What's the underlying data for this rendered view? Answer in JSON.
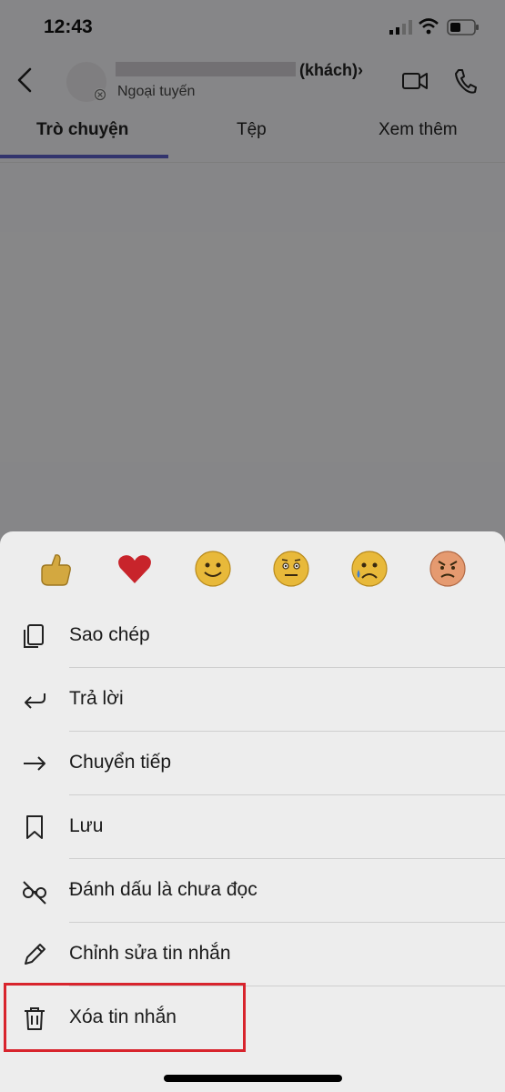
{
  "status_bar": {
    "time": "12:43"
  },
  "header": {
    "name_suffix": "(khách)›",
    "presence_text": "Ngoại tuyến"
  },
  "tabs": [
    {
      "label": "Trò chuyện"
    },
    {
      "label": "Tệp"
    },
    {
      "label": "Xem thêm"
    }
  ],
  "reactions": [
    {
      "icon": "like-emoji-icon"
    },
    {
      "icon": "heart-emoji-icon"
    },
    {
      "icon": "smile-emoji-icon"
    },
    {
      "icon": "surprised-emoji-icon"
    },
    {
      "icon": "sad-emoji-icon"
    },
    {
      "icon": "angry-emoji-icon"
    }
  ],
  "menu": [
    {
      "label": "Sao chép",
      "icon": "copy-icon"
    },
    {
      "label": "Trả lời",
      "icon": "reply-icon"
    },
    {
      "label": "Chuyển tiếp",
      "icon": "forward-icon"
    },
    {
      "label": "Lưu",
      "icon": "bookmark-icon"
    },
    {
      "label": "Đánh dấu là chưa đọc",
      "icon": "mark-unread-icon"
    },
    {
      "label": "Chỉnh sửa tin nhắn",
      "icon": "edit-icon"
    },
    {
      "label": "Xóa tin nhắn",
      "icon": "trash-icon"
    }
  ],
  "colors": {
    "accent": "#5b5fc7",
    "highlight_border": "#d8242d",
    "overlay": "#000000"
  }
}
